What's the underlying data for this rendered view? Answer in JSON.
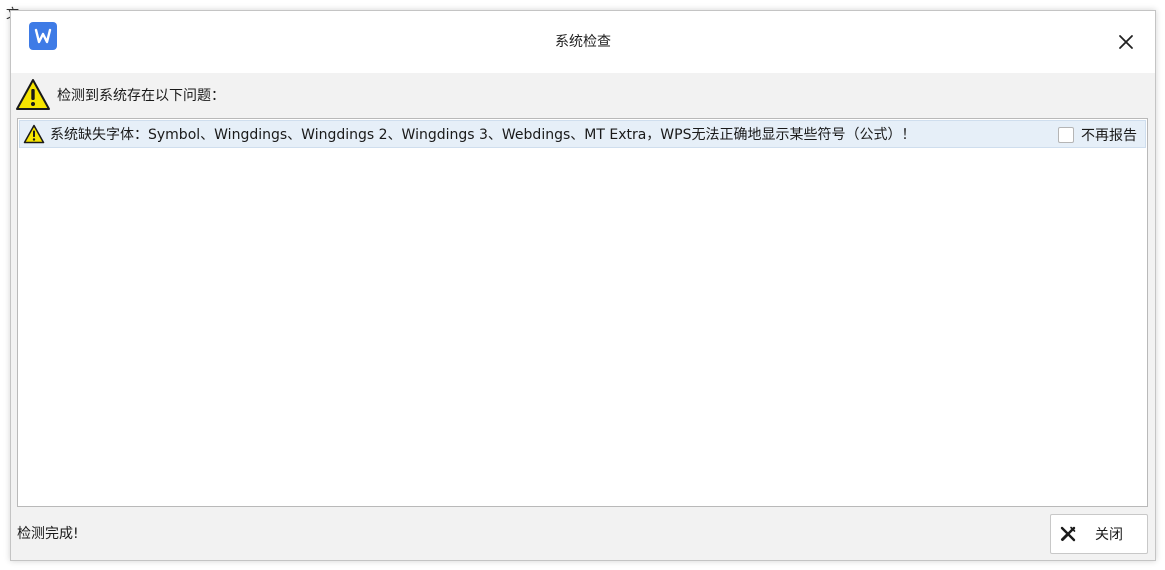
{
  "stray_glyph": "文",
  "window": {
    "title": "系统检查",
    "logo_icon": "wps-writer-logo-icon",
    "close_icon": "close-icon"
  },
  "summary": {
    "icon": "warning-icon",
    "text": "检测到系统存在以下问题："
  },
  "issues": [
    {
      "icon": "warning-icon",
      "text": "系统缺失字体：Symbol、Wingdings、Wingdings 2、Wingdings 3、Webdings、MT Extra，WPS无法正确地显示某些符号（公式）！",
      "dont_report_label": "不再报告",
      "dont_report_checked": false
    }
  ],
  "footer": {
    "status": "检测完成!",
    "close_button_label": "关闭",
    "close_button_icon": "tools-icon"
  },
  "colors": {
    "logo": "#3e7be6",
    "warning_fill": "#f7e500",
    "selected_row": "#e6eff8"
  }
}
